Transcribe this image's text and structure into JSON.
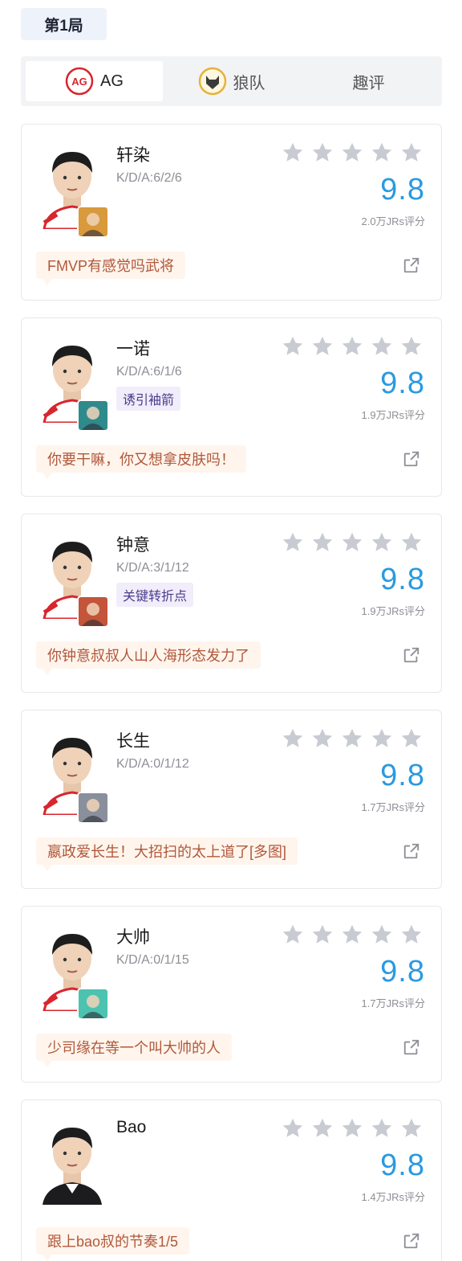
{
  "round_label": "第1局",
  "teams": [
    {
      "label": "AG",
      "active": true,
      "logo": "ag-logo-icon"
    },
    {
      "label": "狼队",
      "active": false,
      "logo": "wolves-logo-icon"
    },
    {
      "label": "趣评",
      "active": false,
      "logo": ""
    }
  ],
  "colors": {
    "score": "#2a9ae0",
    "star": "#c9cbd3",
    "comment_bg": "#fff5ed",
    "comment_text": "#b0583a",
    "tag_bg": "#f1edfa"
  },
  "players": [
    {
      "name": "轩染",
      "kda": "K/D/A:6/2/6",
      "tag": "",
      "score": "9.8",
      "votes": "2.0万JRs评分",
      "comment": "FMVP有感觉吗武将",
      "stars": 5,
      "hero_color": "#d89a3c"
    },
    {
      "name": "一诺",
      "kda": "K/D/A:6/1/6",
      "tag": "诱引袖箭",
      "score": "9.8",
      "votes": "1.9万JRs评分",
      "comment": "你要干嘛，你又想拿皮肤吗！",
      "stars": 5,
      "hero_color": "#2f8a8c"
    },
    {
      "name": "钟意",
      "kda": "K/D/A:3/1/12",
      "tag": "关键转折点",
      "score": "9.8",
      "votes": "1.9万JRs评分",
      "comment": "你钟意叔叔人山人海形态发力了",
      "stars": 5,
      "hero_color": "#c2553a"
    },
    {
      "name": "长生",
      "kda": "K/D/A:0/1/12",
      "tag": "",
      "score": "9.8",
      "votes": "1.7万JRs评分",
      "comment": "嬴政爱长生！大招扫的太上道了[多图]",
      "stars": 5,
      "hero_color": "#8a8f9c"
    },
    {
      "name": "大帅",
      "kda": "K/D/A:0/1/15",
      "tag": "",
      "score": "9.8",
      "votes": "1.7万JRs评分",
      "comment": "少司缘在等一个叫大帅的人",
      "stars": 5,
      "hero_color": "#4cc3b0"
    },
    {
      "name": "Bao",
      "kda": "",
      "tag": "",
      "score": "9.8",
      "votes": "1.4万JRs评分",
      "comment": "跟上bao叔的节奏1/5",
      "stars": 5,
      "hero_color": ""
    }
  ]
}
